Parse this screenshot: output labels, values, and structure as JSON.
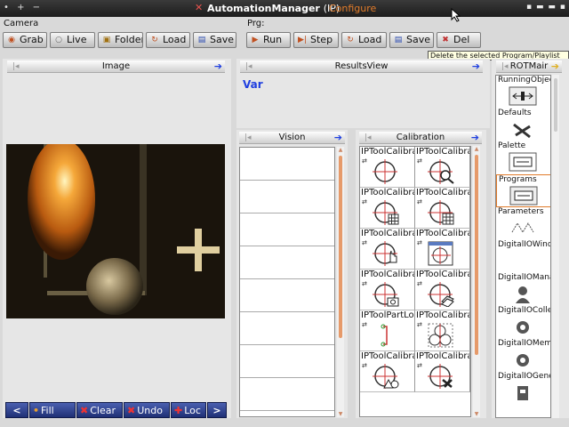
{
  "window": {
    "controls": "• + −",
    "close_glyph": "✕",
    "title": "AutomationManager",
    "tag": "(IP)",
    "configure": "Configure",
    "right_glyphs": "▪ ▬ ▬ ▪"
  },
  "camera": {
    "group_label": "Camera",
    "buttons": [
      {
        "label": "Grab",
        "icon": "camera-icon"
      },
      {
        "label": "Live",
        "icon": "live-icon"
      },
      {
        "label": "Folder",
        "icon": "folder-icon"
      },
      {
        "label": "Load",
        "icon": "load-icon"
      },
      {
        "label": "Save",
        "icon": "save-icon"
      }
    ]
  },
  "program": {
    "group_label": "Prg:",
    "buttons": [
      {
        "label": "Run",
        "icon": "play-icon"
      },
      {
        "label": "Step",
        "icon": "step-icon"
      },
      {
        "label": "Load",
        "icon": "load-icon"
      },
      {
        "label": "Save",
        "icon": "save-icon"
      },
      {
        "label": "Del",
        "icon": "delete-icon"
      }
    ]
  },
  "tooltip": "Delete the selected Program/Playlist",
  "image_panel": {
    "title": "Image"
  },
  "results_panel": {
    "title": "ResultsView",
    "var_label": "Var"
  },
  "vision_panel": {
    "title": "Vision",
    "rows": 8
  },
  "calibration_panel": {
    "title": "Calibration",
    "tools": [
      "IPToolCalibra",
      "IPToolCalibra",
      "IPToolCalibra",
      "IPToolCalibra",
      "IPToolCalibra",
      "IPToolCalibra",
      "IPToolCalibra",
      "IPToolCalibra",
      "IPToolPartLoc",
      "IPToolCalibra",
      "IPToolCalibra",
      "IPToolCalibra"
    ]
  },
  "right_panel": {
    "title": "ROTMair",
    "items": [
      "RunningObject",
      "Defaults",
      "Palette",
      "Programs",
      "Parameters",
      "DigitalIOWindo",
      "DigitalIOMana",
      "DigitalIOColle",
      "DigitalIOMemo",
      "DigitalIOGene"
    ]
  },
  "bottom_bar": {
    "buttons": [
      {
        "label": "Fill",
        "glyph": "•"
      },
      {
        "label": "Clear",
        "glyph": "✖"
      },
      {
        "label": "Undo",
        "glyph": "✖"
      },
      {
        "label": "Loc",
        "glyph": "✚"
      }
    ]
  },
  "colors": {
    "accent_blue": "#1f3fe0",
    "scroll_orange": "#e69a6a",
    "configure_orange": "#e07b2a",
    "bottom_bar": "#24348a"
  }
}
